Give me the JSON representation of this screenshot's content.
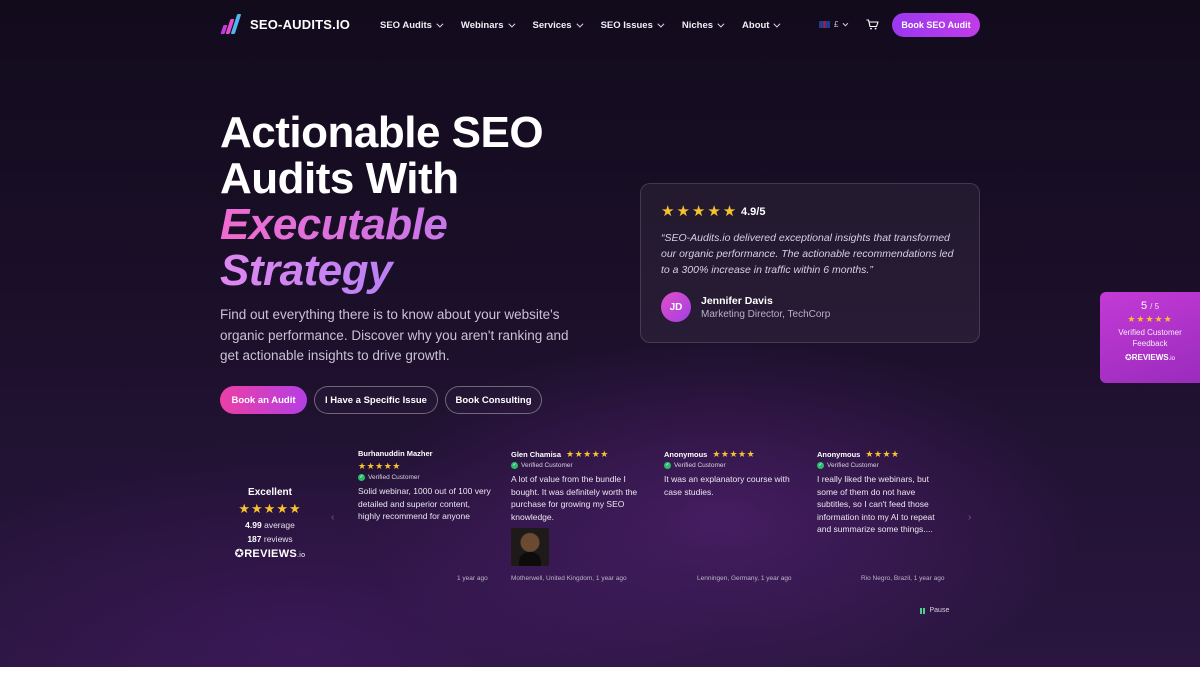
{
  "nav": {
    "logo_text": "SEO-AUDITS.IO",
    "menu": [
      {
        "label": "SEO Audits"
      },
      {
        "label": "Webinars"
      },
      {
        "label": "Services"
      },
      {
        "label": "SEO Issues"
      },
      {
        "label": "Niches"
      },
      {
        "label": "About"
      }
    ],
    "locale": "£",
    "book_button": "Book SEO Audit"
  },
  "hero": {
    "title_line1": "Actionable SEO",
    "title_line2": "Audits With",
    "title_accent1": "Executable",
    "title_accent2": "Strategy",
    "subtitle": "Find out everything there is to know about your website's organic performance. Discover why you aren't ranking and get actionable insights to drive growth.",
    "cta_primary": "Book an Audit",
    "cta_issue": "I Have a Specific Issue",
    "cta_consulting": "Book Consulting"
  },
  "testimonial": {
    "stars": "★★★★★",
    "rating": "4.9/5",
    "quote": "“SEO-Audits.io delivered exceptional insights that transformed our organic performance. The actionable recommendations led to a 300% increase in traffic within 6 months.”",
    "initials": "JD",
    "name": "Jennifer Davis",
    "role": "Marketing Director, TechCorp"
  },
  "side_badge": {
    "score": "5",
    "out_of": "/ 5",
    "stars": "★★★★★",
    "text": "Verified Customer Feedback",
    "logo": "REVIEWS",
    "logo_suffix": ".io"
  },
  "reviews_summary": {
    "title": "Excellent",
    "stars": "★★★★★",
    "average_value": "4.99",
    "average_label": "average",
    "count_value": "187",
    "count_label": "reviews",
    "logo": "REVIEWS",
    "logo_suffix": ".io"
  },
  "reviews": [
    {
      "name": "Burhanuddin Mazher",
      "stars": "★★★★★",
      "verified": "Verified Customer",
      "text": "Solid webinar, 1000 out of 100 very detailed and superior content, highly recommend for anyone",
      "meta": "1 year ago"
    },
    {
      "name": "Glen Chamisa",
      "stars": "★★★★★",
      "verified": "Verified Customer",
      "text": "A lot of value from the bundle I bought. It was definitely worth the purchase for growing my SEO knowledge.",
      "meta": "Motherwell, United Kingdom, 1 year ago"
    },
    {
      "name": "Anonymous",
      "stars": "★★★★★",
      "verified": "Verified Customer",
      "text": "It was an explanatory course with case studies.",
      "meta": "Lenningen, Germany, 1 year ago"
    },
    {
      "name": "Anonymous",
      "stars": "★★★★",
      "verified": "Verified Customer",
      "text": "I really liked the webinars, but some of them do not have subtitles, so I can't feed those information into my AI to repeat and summarize some things....",
      "meta": "Rio Negro, Brazil, 1 year ago"
    }
  ],
  "carousel": {
    "prev": "‹",
    "next": "›",
    "pause_label": "Pause"
  },
  "colors": {
    "accent_purple": "#9a38f0",
    "accent_pink": "#ec3fa6",
    "star": "#f6c22e",
    "verified_green": "#2bbd6e"
  }
}
